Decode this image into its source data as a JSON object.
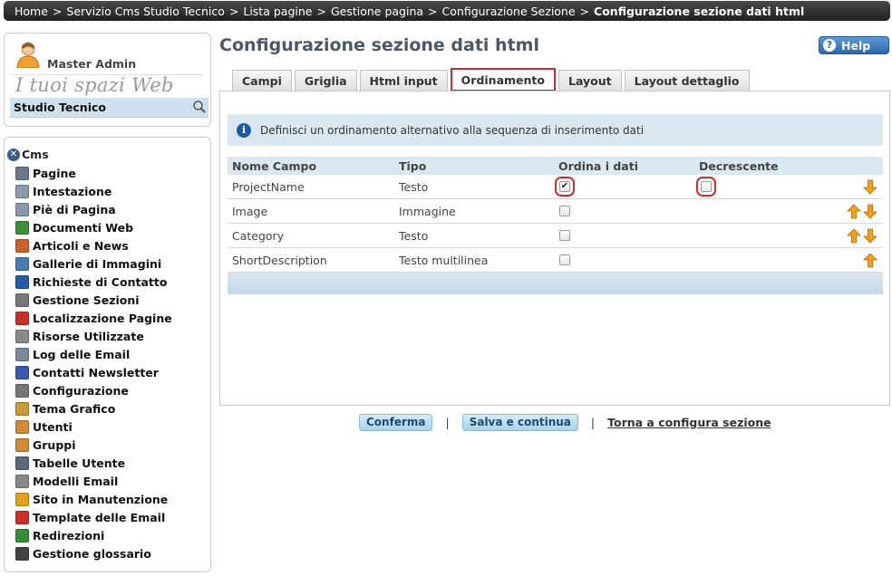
{
  "breadcrumb": [
    "Home",
    "Servizio Cms Studio Tecnico",
    "Lista pagine",
    "Gestione pagina",
    "Configurazione Sezione",
    "Configurazione sezione dati html"
  ],
  "user": {
    "name": "Master Admin",
    "spaces_title": "I tuoi spazi Web",
    "site": "Studio Tecnico"
  },
  "menu": {
    "root": "Cms",
    "items": [
      {
        "label": "Pagine",
        "icon": "page-icon",
        "color": "#6b7a8a"
      },
      {
        "label": "Intestazione",
        "icon": "header-icon",
        "color": "#8a9aaa"
      },
      {
        "label": "Piè di Pagina",
        "icon": "footer-icon",
        "color": "#8a9aaa"
      },
      {
        "label": "Documenti Web",
        "icon": "web-documents-icon",
        "color": "#3e8e3e"
      },
      {
        "label": "Articoli e News",
        "icon": "news-icon",
        "color": "#c8642a"
      },
      {
        "label": "Gallerie di Immagini",
        "icon": "image-gallery-icon",
        "color": "#4a7bb0"
      },
      {
        "label": "Richieste di Contatto",
        "icon": "contact-requests-icon",
        "color": "#2a5aa0"
      },
      {
        "label": "Gestione Sezioni",
        "icon": "sections-icon",
        "color": "#777777"
      },
      {
        "label": "Localizzazione Pagine",
        "icon": "localization-icon",
        "color": "#c8302a"
      },
      {
        "label": "Risorse Utilizzate",
        "icon": "resources-icon",
        "color": "#888888"
      },
      {
        "label": "Log delle Email",
        "icon": "email-log-icon",
        "color": "#7a8a9a"
      },
      {
        "label": "Contatti Newsletter",
        "icon": "newsletter-contacts-icon",
        "color": "#3a5ab0"
      },
      {
        "label": "Configurazione",
        "icon": "gear-icon",
        "color": "#777777"
      },
      {
        "label": "Tema Grafico",
        "icon": "theme-icon",
        "color": "#c89a3a"
      },
      {
        "label": "Utenti",
        "icon": "user-icon",
        "color": "#d08a3a"
      },
      {
        "label": "Gruppi",
        "icon": "group-icon",
        "color": "#d08a3a"
      },
      {
        "label": "Tabelle Utente",
        "icon": "table-icon",
        "color": "#5a6a7a"
      },
      {
        "label": "Modelli Email",
        "icon": "email-template-icon",
        "color": "#888888"
      },
      {
        "label": "Sito in Manutenzione",
        "icon": "maintenance-icon",
        "color": "#e0a020"
      },
      {
        "label": "Template delle Email",
        "icon": "mail-icon",
        "color": "#c8302a"
      },
      {
        "label": "Redirezioni",
        "icon": "redirect-icon",
        "color": "#3a8a3a"
      },
      {
        "label": "Gestione glossario",
        "icon": "glossary-icon",
        "color": "#444444"
      }
    ]
  },
  "page": {
    "title": "Configurazione sezione dati html",
    "help_label": "Help"
  },
  "tabs": [
    {
      "label": "Campi",
      "active": false
    },
    {
      "label": "Griglia",
      "active": false
    },
    {
      "label": "Html input",
      "active": false
    },
    {
      "label": "Ordinamento",
      "active": true
    },
    {
      "label": "Layout",
      "active": false
    },
    {
      "label": "Layout dettaglio",
      "active": false
    }
  ],
  "info": "Definisci un ordinamento alternativo alla sequenza di inserimento dati",
  "grid": {
    "headers": [
      "Nome Campo",
      "Tipo",
      "Ordina i dati",
      "Decrescente"
    ],
    "rows": [
      {
        "name": "ProjectName",
        "type": "Testo",
        "sort": true,
        "desc": false
      },
      {
        "name": "Image",
        "type": "Immagine",
        "sort": false,
        "desc": null
      },
      {
        "name": "Category",
        "type": "Testo",
        "sort": false,
        "desc": null
      },
      {
        "name": "ShortDescription",
        "type": "Testo multilinea",
        "sort": false,
        "desc": null
      }
    ]
  },
  "actions": {
    "confirm": "Conferma",
    "save_continue": "Salva e continua",
    "back": "Torna a configura sezione"
  },
  "colors": {
    "accent": "#cc2c2c",
    "arrow": "#f0a020",
    "panel_blue": "#dbe7f1"
  }
}
